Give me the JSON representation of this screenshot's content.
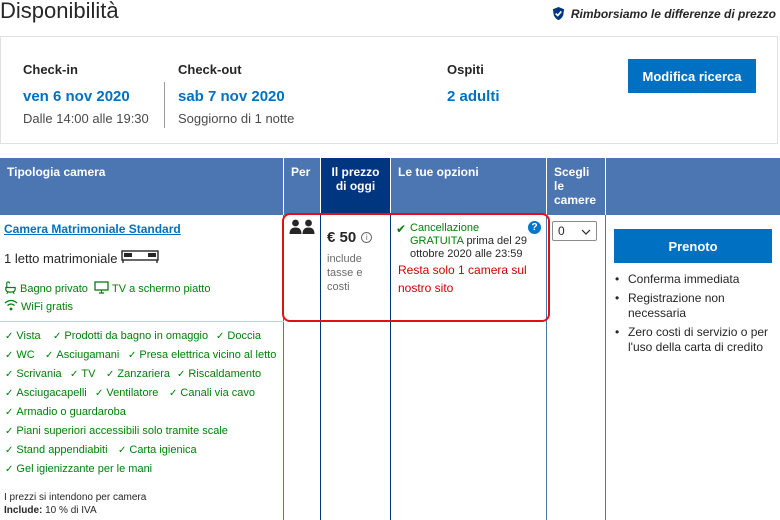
{
  "header": {
    "title": "Disponibilità",
    "refund_text": "Rimborsiamo le differenze di prezzo",
    "refund_icon": "shield-check-icon"
  },
  "search": {
    "checkin_label": "Check-in",
    "checkin_date": "ven 6 nov 2020",
    "checkin_time": "Dalle 14:00 alle 19:30",
    "checkout_label": "Check-out",
    "checkout_date": "sab 7 nov 2020",
    "stay": "Soggiorno di 1 notte",
    "guests_label": "Ospiti",
    "guests_value": "2 adulti",
    "modify_button": "Modifica ricerca"
  },
  "table": {
    "headers": {
      "room_type": "Tipologia camera",
      "per": "Per",
      "price_line1": "Il prezzo",
      "price_line2": "di oggi",
      "options": "Le tue opzioni",
      "choose_line1": "Scegli",
      "choose_line2": "le",
      "choose_line3": "camere"
    },
    "room": {
      "name": "Camera Matrimoniale Standard",
      "bed": "1 letto matrimoniale",
      "amenities": [
        "Bagno privato",
        "TV a schermo piatto",
        "WiFi gratis"
      ],
      "features": [
        "Vista",
        "Prodotti da bagno in omaggio",
        "Doccia",
        "WC",
        "Asciugamani",
        "Presa elettrica vicino al letto",
        "Scrivania",
        "TV",
        "Zanzariera",
        "Riscaldamento",
        "Asciugacapelli",
        "Ventilatore",
        "Canali via cavo",
        "Armadio o guardaroba",
        "Piani superiori accessibili solo tramite scale",
        "Stand appendiabiti",
        "Carta igienica",
        "Gel igienizzante per le mani"
      ],
      "note_per_room": "I prezzi si intendono per camera",
      "note_include_label": "Include:",
      "note_include_value": "10 % di IVA"
    },
    "price": {
      "amount": "€ 50",
      "sub": "include tasse e costi"
    },
    "options": {
      "cancel_line1": "Cancellazione",
      "cancel_free": "GRATUITA",
      "cancel_rest": "prima del 29 ottobre 2020 alle 23:59",
      "scarcity": "Resta solo 1 camera sul nostro sito"
    },
    "select": {
      "value": "0"
    },
    "book_button": "Prenoto",
    "benefits": [
      "Conferma immediata",
      "Registrazione non necessaria",
      "Zero costi di servizio o per l'uso della carta di credito"
    ]
  },
  "colors": {
    "header_blue": "#4c76b2",
    "header_dark": "#003580",
    "link_blue": "#0071c2",
    "green": "#008009",
    "alert_red": "#cc0000",
    "highlight_red": "#e21111"
  }
}
